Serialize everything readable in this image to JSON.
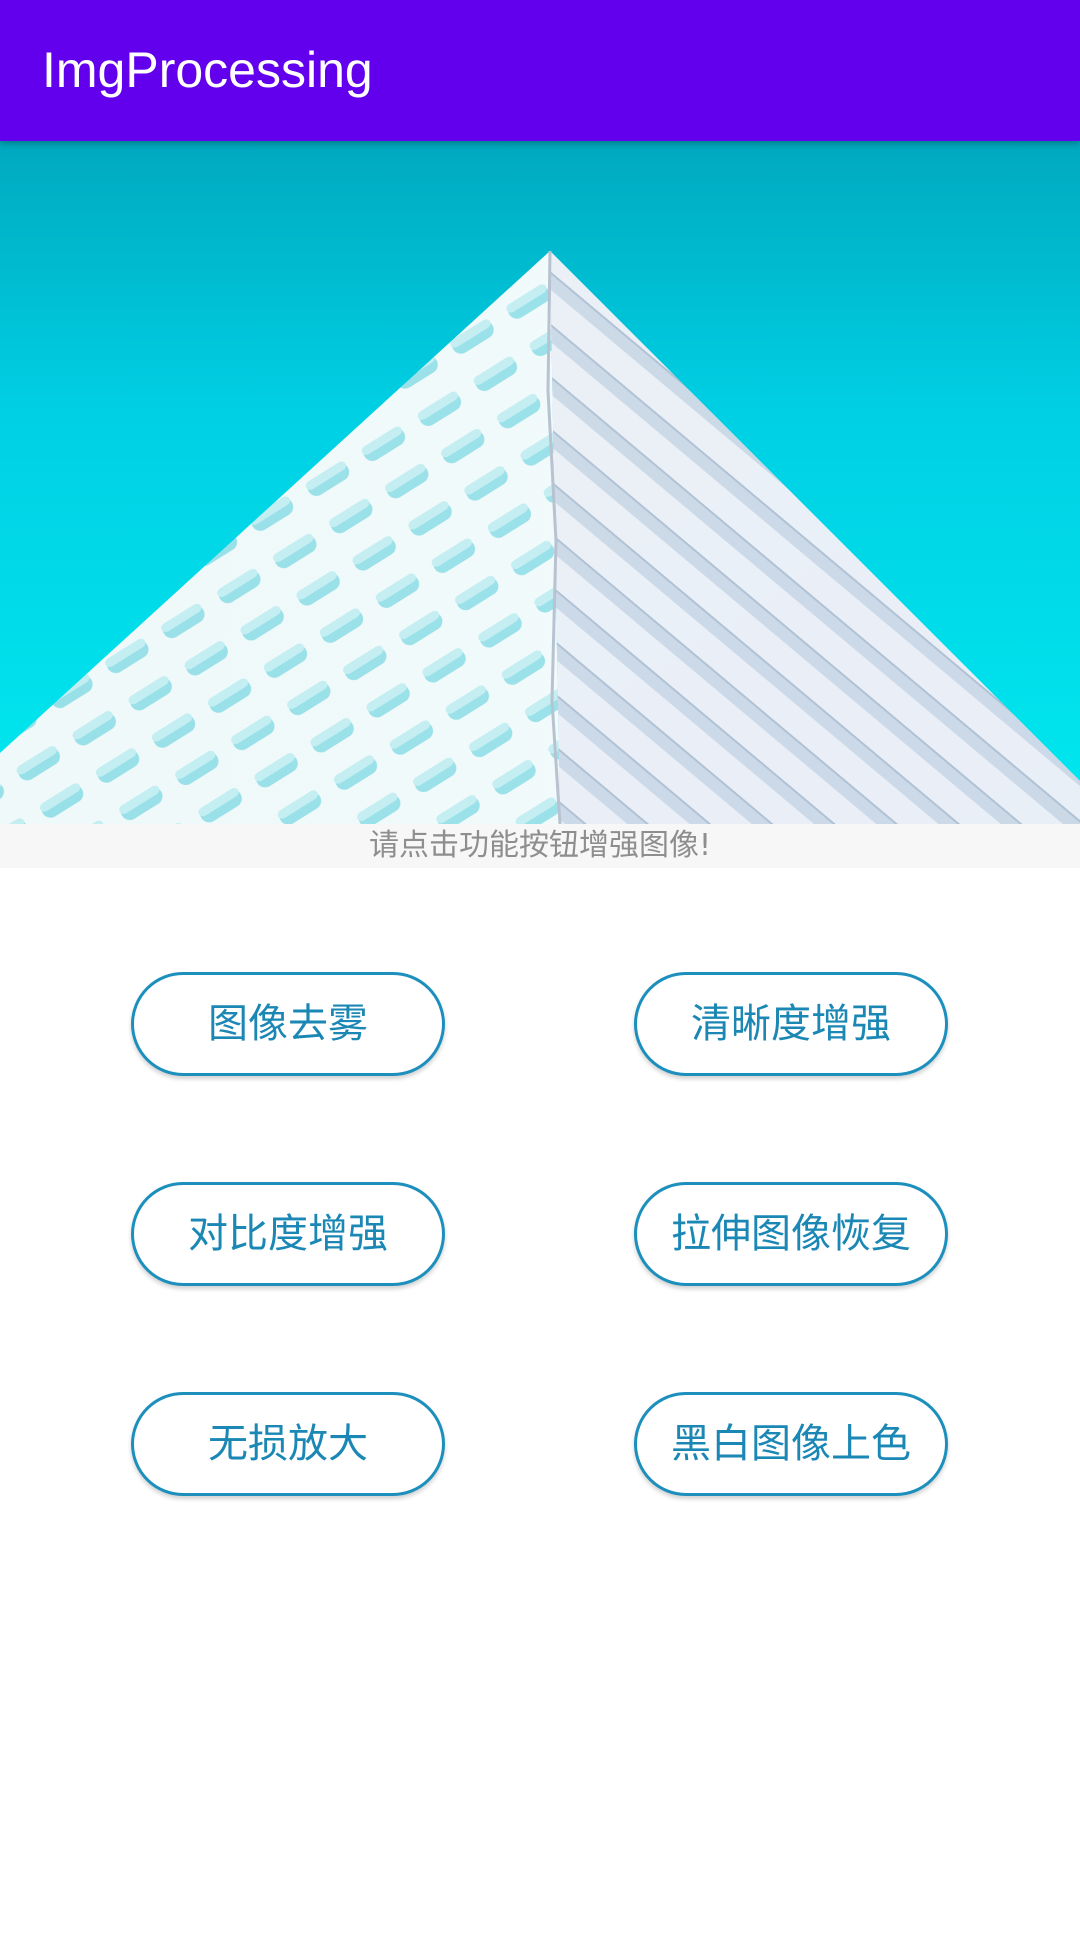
{
  "app_bar": {
    "title": "ImgProcessing",
    "background_color": "#6200EE"
  },
  "image_view": {
    "subject": "white-geometric-building-against-cyan-sky"
  },
  "hint": {
    "text": "请点击功能按钮增强图像!"
  },
  "buttons": [
    {
      "label": "图像去雾"
    },
    {
      "label": "清晰度增强"
    },
    {
      "label": "对比度增强"
    },
    {
      "label": "拉伸图像恢复"
    },
    {
      "label": "无损放大"
    },
    {
      "label": "黑白图像上色"
    }
  ],
  "colors": {
    "accent": "#1c8fbd",
    "button_text": "#1a87b4",
    "hint_text": "#8e8e8e",
    "sky_top": "#00a9bf",
    "sky_bottom": "#00e5ee"
  }
}
